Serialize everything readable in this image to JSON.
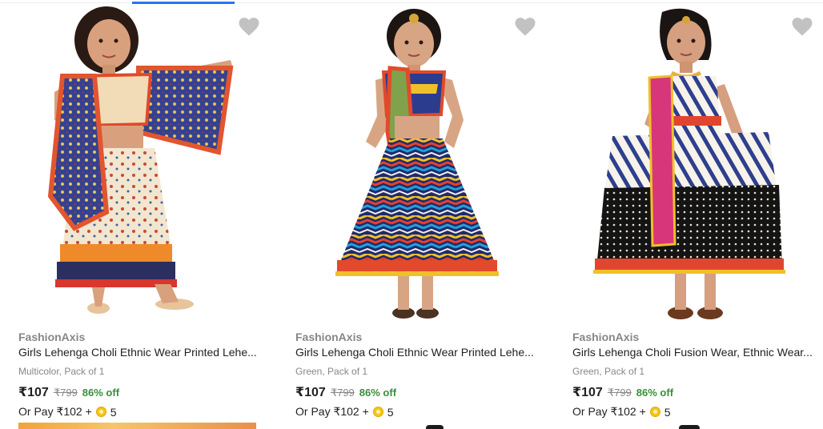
{
  "products": [
    {
      "brand": "FashionAxis",
      "title": "Girls Lehenga Choli Ethnic Wear Printed Lehe...",
      "variant": "Multicolor, Pack of 1",
      "price": "₹107",
      "mrp": "₹799",
      "discount": "86% off",
      "pay_prefix": "Or Pay ₹102 +",
      "coins": "5",
      "wishlist_icon": "heart-icon"
    },
    {
      "brand": "FashionAxis",
      "title": "Girls Lehenga Choli Ethnic Wear Printed Lehe...",
      "variant": "Green, Pack of 1",
      "price": "₹107",
      "mrp": "₹799",
      "discount": "86% off",
      "pay_prefix": "Or Pay ₹102 +",
      "coins": "5",
      "wishlist_icon": "heart-icon"
    },
    {
      "brand": "FashionAxis",
      "title": "Girls Lehenga Choli Fusion Wear, Ethnic Wear...",
      "variant": "Green, Pack of 1",
      "price": "₹107",
      "mrp": "₹799",
      "discount": "86% off",
      "pay_prefix": "Or Pay ₹102 +",
      "coins": "5",
      "wishlist_icon": "heart-icon"
    }
  ],
  "colors": {
    "accent": "#2874f0",
    "discount": "#388e3c",
    "muted": "#878787",
    "wishlist": "#c2c2c2",
    "coin": "#f5c518"
  }
}
